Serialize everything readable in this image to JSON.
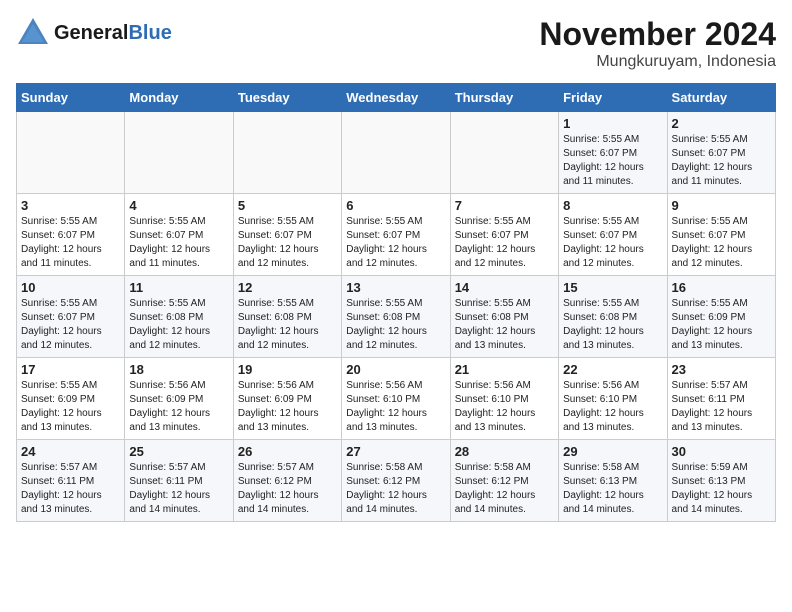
{
  "logo": {
    "general": "General",
    "blue": "Blue",
    "tagline": ""
  },
  "header": {
    "month_year": "November 2024",
    "location": "Mungkuruyam, Indonesia"
  },
  "days_of_week": [
    "Sunday",
    "Monday",
    "Tuesday",
    "Wednesday",
    "Thursday",
    "Friday",
    "Saturday"
  ],
  "weeks": [
    [
      {
        "day": "",
        "content": ""
      },
      {
        "day": "",
        "content": ""
      },
      {
        "day": "",
        "content": ""
      },
      {
        "day": "",
        "content": ""
      },
      {
        "day": "",
        "content": ""
      },
      {
        "day": "1",
        "content": "Sunrise: 5:55 AM\nSunset: 6:07 PM\nDaylight: 12 hours\nand 11 minutes."
      },
      {
        "day": "2",
        "content": "Sunrise: 5:55 AM\nSunset: 6:07 PM\nDaylight: 12 hours\nand 11 minutes."
      }
    ],
    [
      {
        "day": "3",
        "content": "Sunrise: 5:55 AM\nSunset: 6:07 PM\nDaylight: 12 hours\nand 11 minutes."
      },
      {
        "day": "4",
        "content": "Sunrise: 5:55 AM\nSunset: 6:07 PM\nDaylight: 12 hours\nand 11 minutes."
      },
      {
        "day": "5",
        "content": "Sunrise: 5:55 AM\nSunset: 6:07 PM\nDaylight: 12 hours\nand 12 minutes."
      },
      {
        "day": "6",
        "content": "Sunrise: 5:55 AM\nSunset: 6:07 PM\nDaylight: 12 hours\nand 12 minutes."
      },
      {
        "day": "7",
        "content": "Sunrise: 5:55 AM\nSunset: 6:07 PM\nDaylight: 12 hours\nand 12 minutes."
      },
      {
        "day": "8",
        "content": "Sunrise: 5:55 AM\nSunset: 6:07 PM\nDaylight: 12 hours\nand 12 minutes."
      },
      {
        "day": "9",
        "content": "Sunrise: 5:55 AM\nSunset: 6:07 PM\nDaylight: 12 hours\nand 12 minutes."
      }
    ],
    [
      {
        "day": "10",
        "content": "Sunrise: 5:55 AM\nSunset: 6:07 PM\nDaylight: 12 hours\nand 12 minutes."
      },
      {
        "day": "11",
        "content": "Sunrise: 5:55 AM\nSunset: 6:08 PM\nDaylight: 12 hours\nand 12 minutes."
      },
      {
        "day": "12",
        "content": "Sunrise: 5:55 AM\nSunset: 6:08 PM\nDaylight: 12 hours\nand 12 minutes."
      },
      {
        "day": "13",
        "content": "Sunrise: 5:55 AM\nSunset: 6:08 PM\nDaylight: 12 hours\nand 12 minutes."
      },
      {
        "day": "14",
        "content": "Sunrise: 5:55 AM\nSunset: 6:08 PM\nDaylight: 12 hours\nand 13 minutes."
      },
      {
        "day": "15",
        "content": "Sunrise: 5:55 AM\nSunset: 6:08 PM\nDaylight: 12 hours\nand 13 minutes."
      },
      {
        "day": "16",
        "content": "Sunrise: 5:55 AM\nSunset: 6:09 PM\nDaylight: 12 hours\nand 13 minutes."
      }
    ],
    [
      {
        "day": "17",
        "content": "Sunrise: 5:55 AM\nSunset: 6:09 PM\nDaylight: 12 hours\nand 13 minutes."
      },
      {
        "day": "18",
        "content": "Sunrise: 5:56 AM\nSunset: 6:09 PM\nDaylight: 12 hours\nand 13 minutes."
      },
      {
        "day": "19",
        "content": "Sunrise: 5:56 AM\nSunset: 6:09 PM\nDaylight: 12 hours\nand 13 minutes."
      },
      {
        "day": "20",
        "content": "Sunrise: 5:56 AM\nSunset: 6:10 PM\nDaylight: 12 hours\nand 13 minutes."
      },
      {
        "day": "21",
        "content": "Sunrise: 5:56 AM\nSunset: 6:10 PM\nDaylight: 12 hours\nand 13 minutes."
      },
      {
        "day": "22",
        "content": "Sunrise: 5:56 AM\nSunset: 6:10 PM\nDaylight: 12 hours\nand 13 minutes."
      },
      {
        "day": "23",
        "content": "Sunrise: 5:57 AM\nSunset: 6:11 PM\nDaylight: 12 hours\nand 13 minutes."
      }
    ],
    [
      {
        "day": "24",
        "content": "Sunrise: 5:57 AM\nSunset: 6:11 PM\nDaylight: 12 hours\nand 13 minutes."
      },
      {
        "day": "25",
        "content": "Sunrise: 5:57 AM\nSunset: 6:11 PM\nDaylight: 12 hours\nand 14 minutes."
      },
      {
        "day": "26",
        "content": "Sunrise: 5:57 AM\nSunset: 6:12 PM\nDaylight: 12 hours\nand 14 minutes."
      },
      {
        "day": "27",
        "content": "Sunrise: 5:58 AM\nSunset: 6:12 PM\nDaylight: 12 hours\nand 14 minutes."
      },
      {
        "day": "28",
        "content": "Sunrise: 5:58 AM\nSunset: 6:12 PM\nDaylight: 12 hours\nand 14 minutes."
      },
      {
        "day": "29",
        "content": "Sunrise: 5:58 AM\nSunset: 6:13 PM\nDaylight: 12 hours\nand 14 minutes."
      },
      {
        "day": "30",
        "content": "Sunrise: 5:59 AM\nSunset: 6:13 PM\nDaylight: 12 hours\nand 14 minutes."
      }
    ]
  ]
}
